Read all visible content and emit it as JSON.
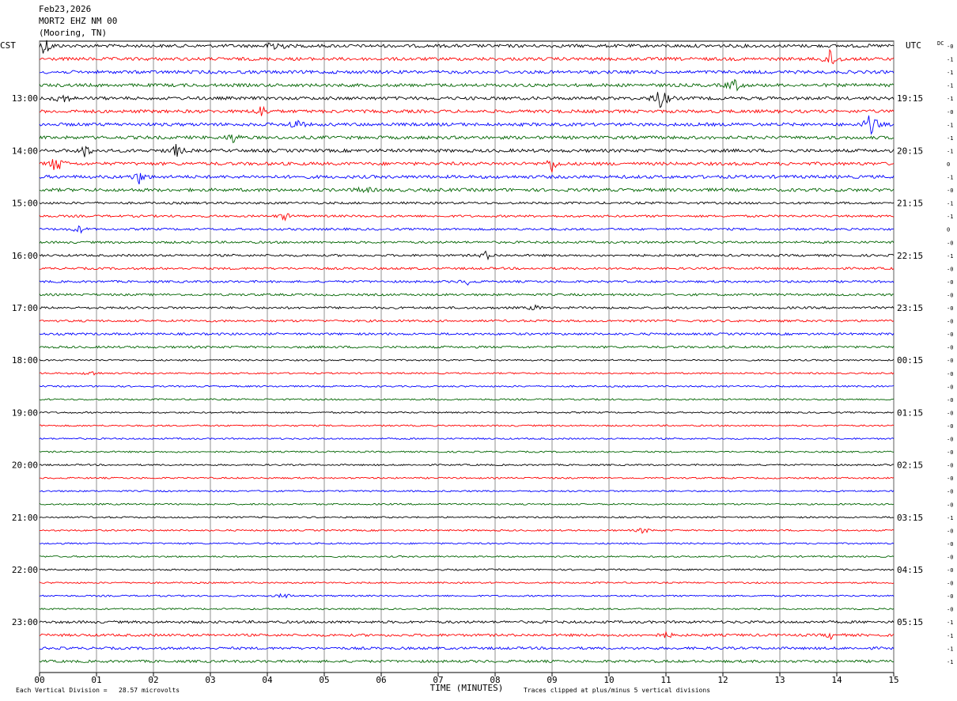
{
  "header": {
    "date": "Feb23,2026",
    "station": "MORT2 EHZ NM 00",
    "location": "(Mooring, TN)"
  },
  "labels": {
    "left_tz": "CST",
    "right_tz": "UTC",
    "dc": "DC",
    "xlabel": "TIME (MINUTES)",
    "division_note": "Each Vertical Division =   28.57 microvolts",
    "clip_note": "Traces clipped at plus/minus 5 vertical divisions"
  },
  "chart_data": {
    "type": "line",
    "title": "MORT2 EHZ NM 00",
    "xlabel": "TIME (MINUTES)",
    "xlim": [
      0,
      15
    ],
    "x_ticks": [
      "00",
      "01",
      "02",
      "03",
      "04",
      "05",
      "06",
      "07",
      "08",
      "09",
      "10",
      "11",
      "12",
      "13",
      "14",
      "15"
    ],
    "trace_count": 48,
    "trace_colors": [
      "#000000",
      "#ff0000",
      "#0000ff",
      "#006400"
    ],
    "left_hour_labels": [
      "13:00",
      "14:00",
      "15:00",
      "16:00",
      "17:00",
      "18:00",
      "19:00",
      "20:00",
      "21:00",
      "22:00",
      "23:00"
    ],
    "right_hour_labels": [
      "19:15",
      "20:15",
      "21:15",
      "22:15",
      "23:15",
      "00:15",
      "01:15",
      "02:15",
      "03:15",
      "04:15",
      "05:15"
    ],
    "dc_offsets": [
      "-0",
      "-1",
      "-1",
      "-1",
      "-1",
      "-0",
      "-1",
      "-1",
      "-1",
      "0",
      "-1",
      "-0",
      "-1",
      "-1",
      "0",
      "-0",
      "-1",
      "-0",
      "-0",
      "-0",
      "-0",
      "-0",
      "-0",
      "-0",
      "-0",
      "-0",
      "-0",
      "-0",
      "-0",
      "-0",
      "-0",
      "-0",
      "-0",
      "-0",
      "-0",
      "-0",
      "-1",
      "-0",
      "-0",
      "-0",
      "-0",
      "-0",
      "-0",
      "-0",
      "-1",
      "-1",
      "-1",
      "-1"
    ],
    "events": [
      {
        "trace": 0,
        "minute": 0.1,
        "amp": 1.6
      },
      {
        "trace": 0,
        "minute": 4.15,
        "amp": 1.5
      },
      {
        "trace": 1,
        "minute": 13.9,
        "amp": 2.0
      },
      {
        "trace": 3,
        "minute": 12.2,
        "amp": 1.2
      },
      {
        "trace": 4,
        "minute": 0.4,
        "amp": 1.0
      },
      {
        "trace": 4,
        "minute": 10.9,
        "amp": 2.5
      },
      {
        "trace": 5,
        "minute": 3.9,
        "amp": 1.0
      },
      {
        "trace": 6,
        "minute": 4.5,
        "amp": 1.0
      },
      {
        "trace": 6,
        "minute": 14.6,
        "amp": 2.2
      },
      {
        "trace": 7,
        "minute": 3.4,
        "amp": 0.8
      },
      {
        "trace": 8,
        "minute": 0.8,
        "amp": 1.0
      },
      {
        "trace": 8,
        "minute": 2.4,
        "amp": 1.0
      },
      {
        "trace": 9,
        "minute": 0.3,
        "amp": 1.6
      },
      {
        "trace": 9,
        "minute": 9.0,
        "amp": 1.2
      },
      {
        "trace": 10,
        "minute": 1.75,
        "amp": 1.0
      },
      {
        "trace": 11,
        "minute": 5.7,
        "amp": 0.6
      },
      {
        "trace": 13,
        "minute": 4.3,
        "amp": 0.6
      },
      {
        "trace": 14,
        "minute": 0.7,
        "amp": 0.6
      },
      {
        "trace": 16,
        "minute": 7.85,
        "amp": 0.7
      },
      {
        "trace": 18,
        "minute": 7.5,
        "amp": 0.5
      },
      {
        "trace": 20,
        "minute": 8.7,
        "amp": 0.4
      },
      {
        "trace": 25,
        "minute": 0.9,
        "amp": 0.5
      },
      {
        "trace": 37,
        "minute": 10.6,
        "amp": 0.5
      },
      {
        "trace": 42,
        "minute": 4.3,
        "amp": 0.5
      },
      {
        "trace": 45,
        "minute": 11.0,
        "amp": 0.5
      },
      {
        "trace": 45,
        "minute": 13.9,
        "amp": 0.5
      }
    ]
  }
}
